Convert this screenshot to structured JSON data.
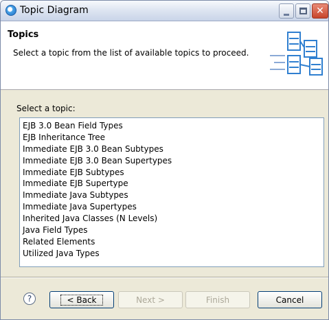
{
  "window": {
    "title": "Topic Diagram",
    "close_glyph": "✕"
  },
  "header": {
    "title": "Topics",
    "description": "Select a topic from the list of available topics to proceed."
  },
  "list": {
    "label": "Select a topic:",
    "items": [
      "EJB 3.0 Bean Field Types",
      "EJB Inheritance Tree",
      "Immediate EJB 3.0 Bean Subtypes",
      "Immediate EJB 3.0 Bean Supertypes",
      "Immediate EJB Subtypes",
      "Immediate EJB Supertype",
      "Immediate Java Subtypes",
      "Immediate Java Supertypes",
      "Inherited Java Classes (N Levels)",
      "Java Field Types",
      "Related Elements",
      "Utilized Java Types"
    ]
  },
  "buttons": {
    "help": "?",
    "back": "< Back",
    "next": "Next >",
    "finish": "Finish",
    "cancel": "Cancel"
  },
  "colors": {
    "accent": "#4aa3e8",
    "close": "#c7452b"
  }
}
